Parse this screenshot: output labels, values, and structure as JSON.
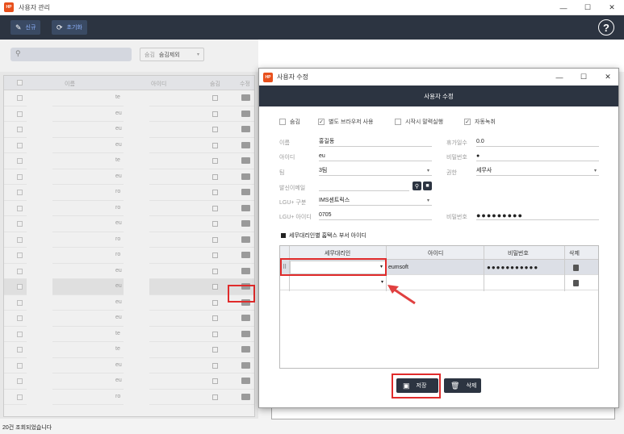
{
  "window": {
    "title": "사용자 관리",
    "logo": "HP"
  },
  "toolbar": {
    "new_label": "신규",
    "refresh_label": "초기화"
  },
  "filters": {
    "hide_label": "숨김",
    "hide_value": "숨김제외"
  },
  "list": {
    "headers": [
      "이름",
      "아이디",
      "숨김",
      "수정"
    ],
    "ids": [
      "te",
      "eu",
      "eu",
      "eu",
      "te",
      "eu",
      "ro",
      "ro",
      "eu",
      "ro",
      "ro",
      "eu",
      "eu",
      "eu",
      "eu",
      "te",
      "te",
      "eu",
      "eu",
      "ro"
    ]
  },
  "status": {
    "text": "20건 조회되었습니다"
  },
  "dialog": {
    "title": "사용자 수정",
    "header": "사용자 수정",
    "checks": [
      {
        "label": "숨김",
        "checked": false
      },
      {
        "label": "별도 브라우저 사용",
        "checked": true
      },
      {
        "label": "시작시 말력실행",
        "checked": false
      },
      {
        "label": "자동녹취",
        "checked": true
      }
    ],
    "fields": {
      "name_label": "이름",
      "name_value": "홍길동",
      "vacation_label": "휴가일수",
      "vacation_value": "0.0",
      "id_label": "아이디",
      "id_value": "eu",
      "pw_label": "비밀번호",
      "pw_value": "●",
      "team_label": "팀",
      "team_value": "3팀",
      "role_label": "권한",
      "role_value": "세무사",
      "email_label": "발신이메일",
      "email_value": "",
      "lgu_type_label": "LGU+ 구분",
      "lgu_type_value": "IMS센트릭스",
      "lgu_id_label": "LGU+ 아이디",
      "lgu_id_value": "0705",
      "lgu_pw_label": "비밀번호",
      "lgu_pw_value": "●●●●●●●●●"
    },
    "section_title": "세무대리인별 홈택스 부서 아이디",
    "grid": {
      "headers": [
        "세무대리인",
        "아이디",
        "비밀번호",
        "삭제"
      ],
      "rows": [
        {
          "agent": "",
          "id": "eumsoft",
          "password": "●●●●●●●●●●●"
        },
        {
          "agent": "",
          "id": "",
          "password": ""
        }
      ]
    },
    "save_label": "저장",
    "delete_label": "삭제"
  }
}
